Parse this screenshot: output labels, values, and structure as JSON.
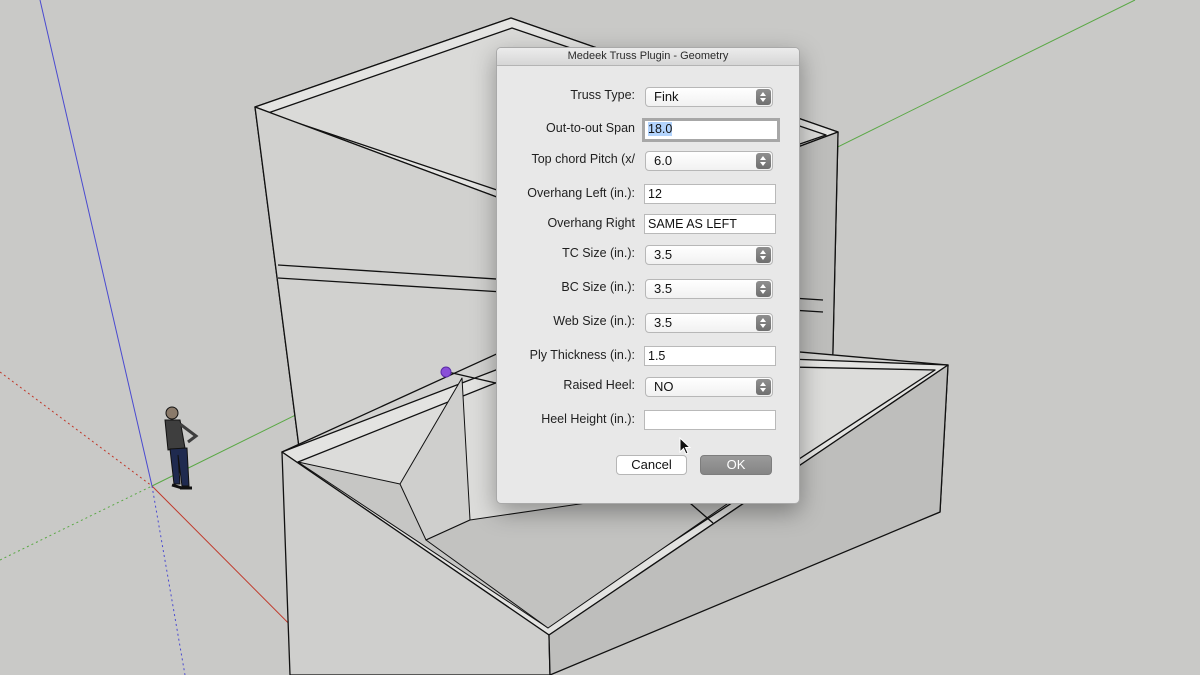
{
  "window": {
    "title": "Medeek Truss Plugin - Geometry"
  },
  "fields": [
    {
      "label": "Truss Type:",
      "type": "select",
      "value": "Fink"
    },
    {
      "label": "Out-to-out Span",
      "type": "text",
      "value": "18.0",
      "focused": true
    },
    {
      "label": "Top chord Pitch (x/",
      "type": "select",
      "value": "6.0"
    },
    {
      "label": "Overhang Left (in.):",
      "type": "text",
      "value": "12"
    },
    {
      "label": "Overhang Right",
      "type": "text",
      "value": "SAME AS LEFT"
    },
    {
      "label": "TC Size (in.):",
      "type": "select",
      "value": "3.5"
    },
    {
      "label": "BC Size (in.):",
      "type": "select",
      "value": "3.5"
    },
    {
      "label": "Web Size (in.):",
      "type": "select",
      "value": "3.5"
    },
    {
      "label": "Ply Thickness (in.):",
      "type": "text",
      "value": "1.5"
    },
    {
      "label": "Raised Heel:",
      "type": "select",
      "value": "NO"
    },
    {
      "label": "Heel Height (in.):",
      "type": "text",
      "value": ""
    }
  ],
  "buttons": {
    "cancel": "Cancel",
    "ok": "OK"
  },
  "colors": {
    "background": "#c9c9c7",
    "axis_blue": "#4a4ad0",
    "axis_green": "#5aa845",
    "axis_red": "#c0392b",
    "selection": "#b3d4fd",
    "point": "#8a4fd8"
  }
}
